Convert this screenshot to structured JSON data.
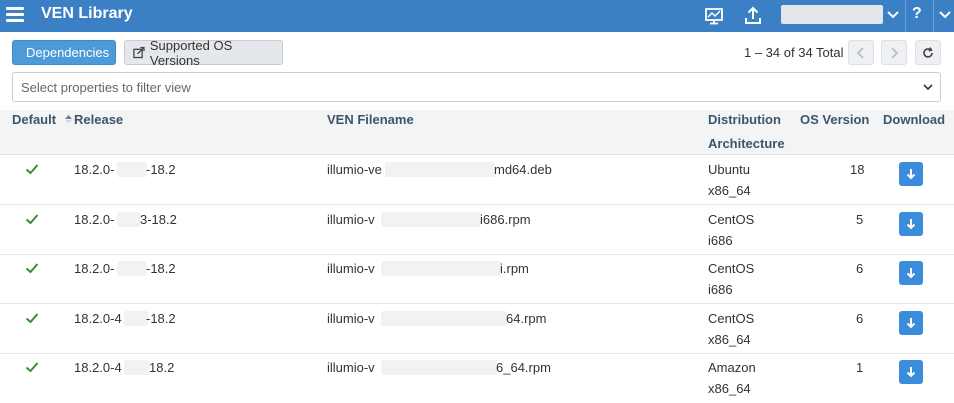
{
  "app": {
    "title": "VEN Library",
    "help_label": "?"
  },
  "toolbar": {
    "dependencies_label": "Dependencies",
    "supported_os_label": "Supported OS Versions",
    "count_text": "1 – 34 of 34 Total"
  },
  "filter": {
    "placeholder": "Select properties to filter view"
  },
  "table": {
    "headers": {
      "default": "Default",
      "release": "Release",
      "filename": "VEN Filename",
      "distribution": "Distribution",
      "architecture": "Architecture",
      "os_version": "OS Version",
      "download": "Download"
    },
    "rows": [
      {
        "release_a": "18.2.0-",
        "release_b": "-18.2",
        "file_a": "illumio-ve",
        "file_b": "md64.deb",
        "distribution": "Ubuntu",
        "architecture": "x86_64",
        "os_version": "18"
      },
      {
        "release_a": "18.2.0-",
        "release_b": "3-18.2",
        "file_a": "illumio-v",
        "file_b": "i686.rpm",
        "distribution": "CentOS",
        "architecture": "i686",
        "os_version": "5"
      },
      {
        "release_a": "18.2.0-",
        "release_b": "-18.2",
        "file_a": "illumio-v",
        "file_b": "i.rpm",
        "distribution": "CentOS",
        "architecture": "i686",
        "os_version": "6"
      },
      {
        "release_a": "18.2.0-4",
        "release_b": "-18.2",
        "file_a": "illumio-v",
        "file_b": "64.rpm",
        "distribution": "CentOS",
        "architecture": "x86_64",
        "os_version": "6"
      },
      {
        "release_a": "18.2.0-4",
        "release_b": "18.2",
        "file_a": "illumio-v",
        "file_b": "6_64.rpm",
        "distribution": "Amazon",
        "architecture": "x86_64",
        "os_version": "1"
      }
    ]
  },
  "colors": {
    "topbar": "#3b7fc4",
    "primary": "#4d9ad8",
    "check": "#3a8a3a",
    "download": "#3b8ddb"
  }
}
